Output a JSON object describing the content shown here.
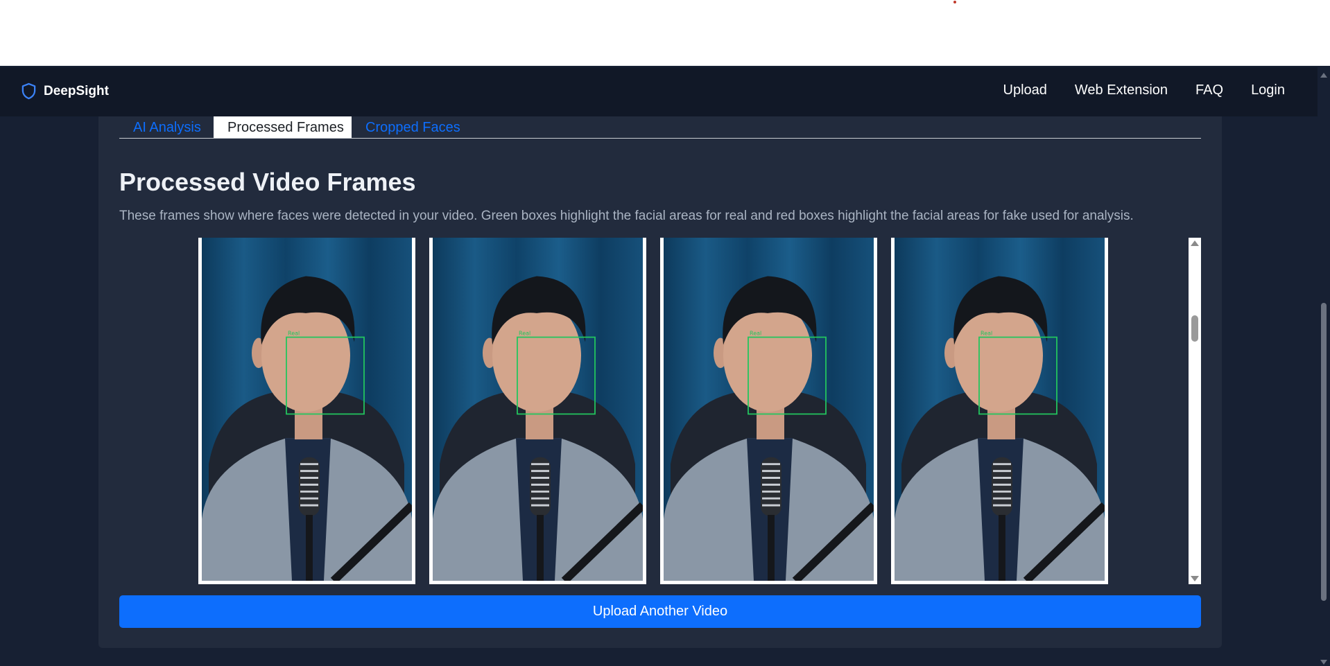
{
  "brand": {
    "name": "DeepSight",
    "icon": "shield-icon"
  },
  "nav": {
    "items": [
      "Upload",
      "Web Extension",
      "FAQ",
      "Login"
    ]
  },
  "tabs": [
    {
      "label": "AI Analysis",
      "active": false
    },
    {
      "label": "Processed Frames",
      "active": true
    },
    {
      "label": "Cropped Faces",
      "active": false
    }
  ],
  "section": {
    "title": "Processed Video Frames",
    "description": "These frames show where faces were detected in your video. Green boxes highlight the facial areas for real and red boxes highlight the facial areas for fake used for analysis."
  },
  "frames": [
    {
      "label": "Real",
      "box_color": "#22c55e"
    },
    {
      "label": "Real",
      "box_color": "#22c55e"
    },
    {
      "label": "Real",
      "box_color": "#22c55e"
    },
    {
      "label": "Real",
      "box_color": "#22c55e"
    }
  ],
  "upload_button": {
    "label": "Upload Another Video"
  },
  "colors": {
    "accent": "#0d6efd",
    "navbar": "#111827",
    "page_bg": "#172033",
    "card_bg": "#222b3d",
    "real_box": "#22c55e",
    "fake_box": "#ef4444"
  }
}
